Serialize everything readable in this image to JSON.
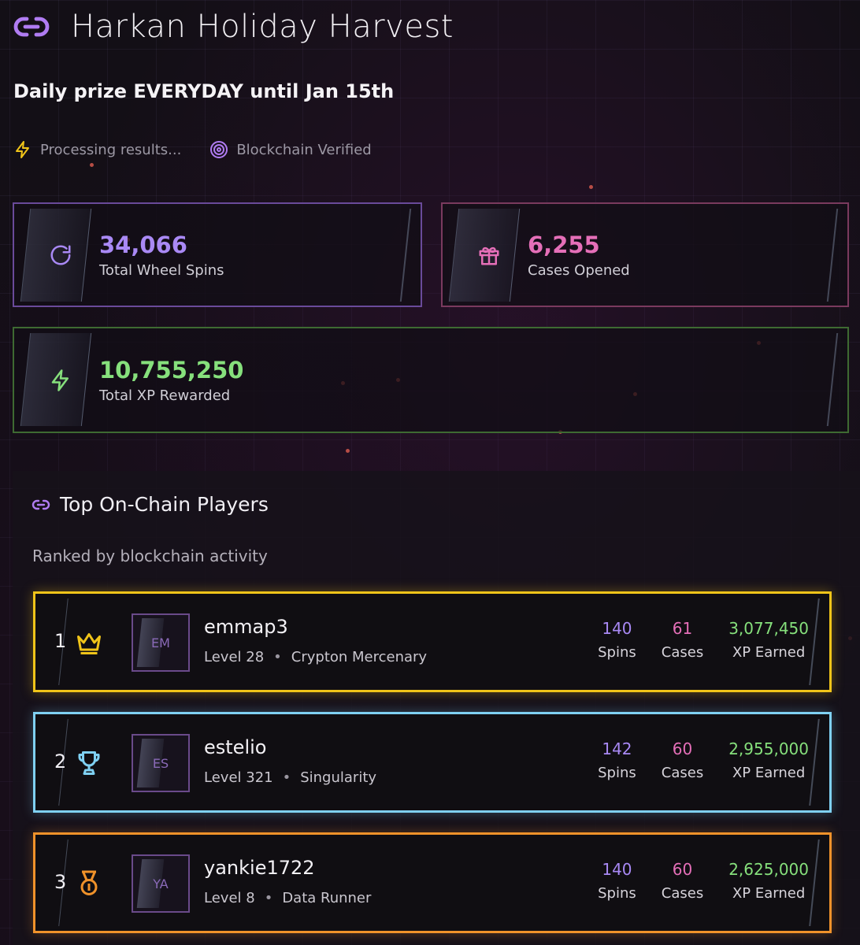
{
  "header": {
    "title": "Harkan Holiday Harvest",
    "subtitle": "Daily prize EVERYDAY until Jan 15th",
    "status_processing": "Processing results...",
    "status_verified": "Blockchain Verified"
  },
  "stats": {
    "spins": {
      "value": "34,066",
      "label": "Total Wheel Spins",
      "color": "#b07cf2"
    },
    "cases": {
      "value": "6,255",
      "label": "Cases Opened",
      "color": "#e86fb5"
    },
    "xp": {
      "value": "10,755,250",
      "label": "Total XP Rewarded",
      "color": "#8be07a"
    }
  },
  "leaderboard": {
    "title": "Top On-Chain Players",
    "subtitle": "Ranked by blockchain activity",
    "players": [
      {
        "rank": "1",
        "icon": "crown-icon",
        "initials": "EM",
        "name": "emmap3",
        "level": "Level 28",
        "title": "Crypton Mercenary",
        "spins": "140",
        "cases": "61",
        "xp": "3,077,450",
        "spins_label": "Spins",
        "cases_label": "Cases",
        "xp_label": "XP Earned",
        "color": "#f0c419"
      },
      {
        "rank": "2",
        "icon": "trophy-icon",
        "initials": "ES",
        "name": "estelio",
        "level": "Level 321",
        "title": "Singularity",
        "spins": "142",
        "cases": "60",
        "xp": "2,955,000",
        "spins_label": "Spins",
        "cases_label": "Cases",
        "xp_label": "XP Earned",
        "color": "#7fd0f2"
      },
      {
        "rank": "3",
        "icon": "medal-icon",
        "initials": "YA",
        "name": "yankie1722",
        "level": "Level 8",
        "title": "Data Runner",
        "spins": "140",
        "cases": "60",
        "xp": "2,625,000",
        "spins_label": "Spins",
        "cases_label": "Cases",
        "xp_label": "XP Earned",
        "color": "#f0922a"
      }
    ]
  },
  "colors": {
    "spins_stat": "#a989f5",
    "cases_stat": "#e56fb8",
    "xp_stat": "#86e07c"
  }
}
